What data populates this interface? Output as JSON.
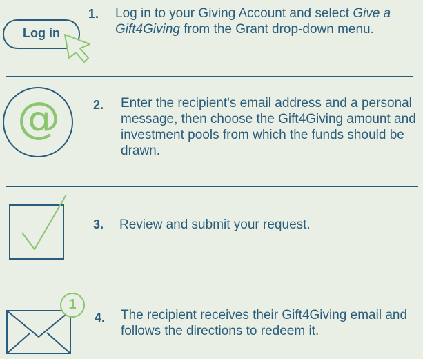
{
  "steps": [
    {
      "number": "1.",
      "text_before": "Log in to your Giving Account and select ",
      "text_italic": "Give a Gift4Giving",
      "text_after": " from the Grant drop-down menu.",
      "button_label": "Log in",
      "icon": "cursor-pointer-icon"
    },
    {
      "number": "2.",
      "text": "Enter the recipient's email address and a personal message, then choose the Gift4Giving amount and investment pools from which the funds should be drawn.",
      "icon": "at-sign-icon",
      "icon_glyph": "@"
    },
    {
      "number": "3.",
      "text": "Review and submit your request.",
      "icon": "checkbox-check-icon"
    },
    {
      "number": "4.",
      "text": "The recipient receives their Gift4Giving email and follows the directions to redeem it.",
      "icon": "envelope-icon",
      "badge": "1"
    }
  ],
  "colors": {
    "background": "#e9efe4",
    "primary": "#2a5c7c",
    "accent": "#8cc56f"
  }
}
